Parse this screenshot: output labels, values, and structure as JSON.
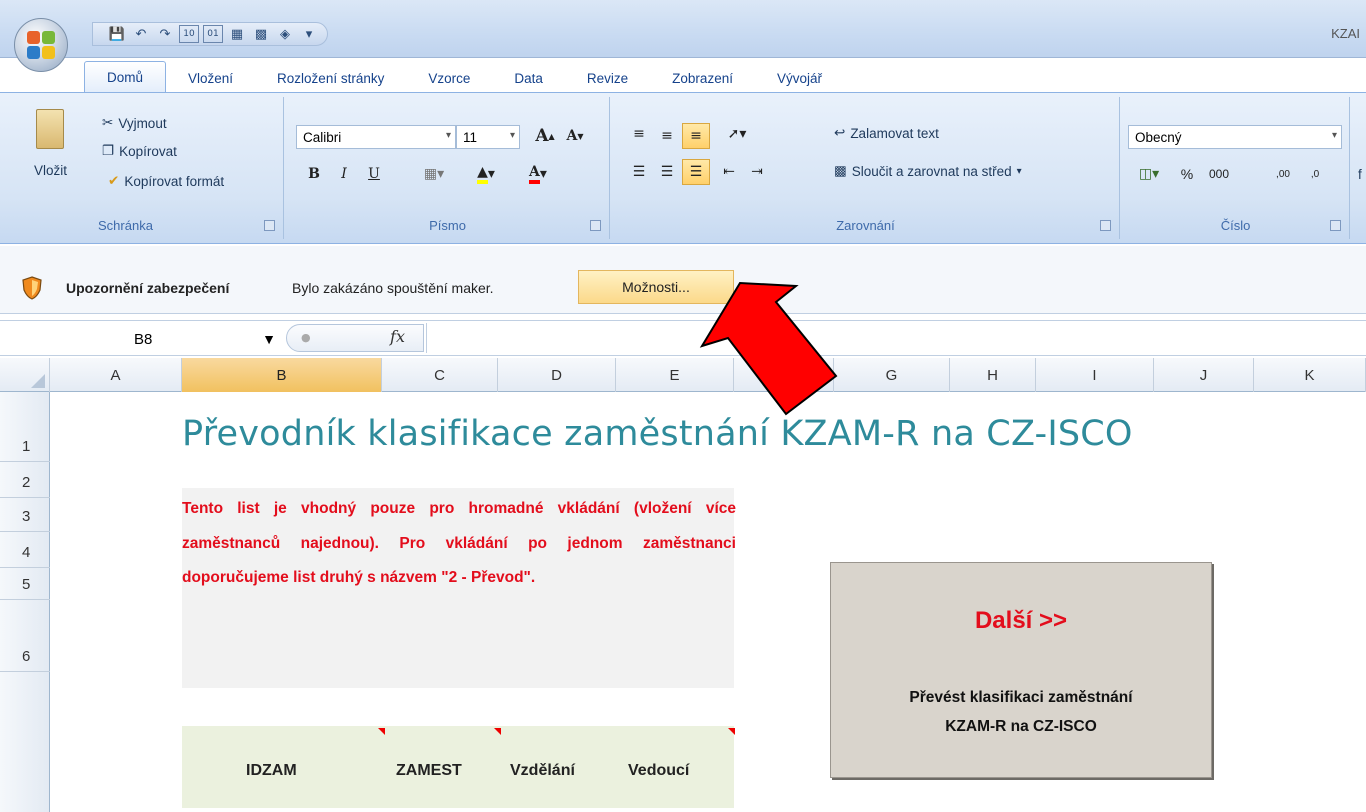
{
  "window": {
    "app_title": "KZAI"
  },
  "tabs": [
    "Domů",
    "Vložení",
    "Rozložení stránky",
    "Vzorce",
    "Data",
    "Revize",
    "Zobrazení",
    "Vývojář"
  ],
  "ribbon": {
    "clipboard": {
      "paste_label": "Vložit",
      "cut_label": "Vyjmout",
      "copy_label": "Kopírovat",
      "format_painter_label": "Kopírovat formát",
      "group_label": "Schránka"
    },
    "font": {
      "font_name": "Calibri",
      "font_size": "11",
      "bold": "B",
      "italic": "I",
      "underline": "U",
      "group_label": "Písmo"
    },
    "alignment": {
      "wrap_text_label": "Zalamovat text",
      "merge_center_label": "Sloučit a zarovnat na střed",
      "group_label": "Zarovnání"
    },
    "number": {
      "format_value": "Obecný",
      "percent": "%",
      "thousands": "000",
      "dec_inc": ",00",
      "dec_dec": ",0",
      "group_label": "Číslo"
    },
    "extra_label": "f"
  },
  "security_bar": {
    "title": "Upozornění zabezpečení",
    "message": "Bylo zakázáno spouštění maker.",
    "button_label": "Možnosti..."
  },
  "formula_bar": {
    "name_box": "B8",
    "fx": "fx"
  },
  "columns": [
    "A",
    "B",
    "C",
    "D",
    "E",
    "F",
    "G",
    "H",
    "I",
    "J",
    "K"
  ],
  "rows": [
    "1",
    "2",
    "3",
    "4",
    "5",
    "6"
  ],
  "sheet": {
    "title": "Převodník klasifikace zaměstnání KZAM-R na CZ-ISCO",
    "note": "Tento list je vhodný pouze pro hromadné vkládání (vložení více zaměstnanců najednou). Pro vkládání po jednom zaměstnanci doporučujeme list druhý s názvem \"2 - Převod\".",
    "table_headers": [
      "IDZAM",
      "ZAMEST",
      "Vzdělání",
      "Vedoucí"
    ],
    "macro_button": {
      "label": "Další >>",
      "description_line1": "Převést klasifikaci zaměstnání",
      "description_line2": "KZAM-R na CZ-ISCO"
    }
  },
  "colors": {
    "title_teal": "#2e8b9b",
    "note_red": "#e30d1c",
    "selected_col": "#f1c15f",
    "arrow_red": "#ff0000"
  }
}
